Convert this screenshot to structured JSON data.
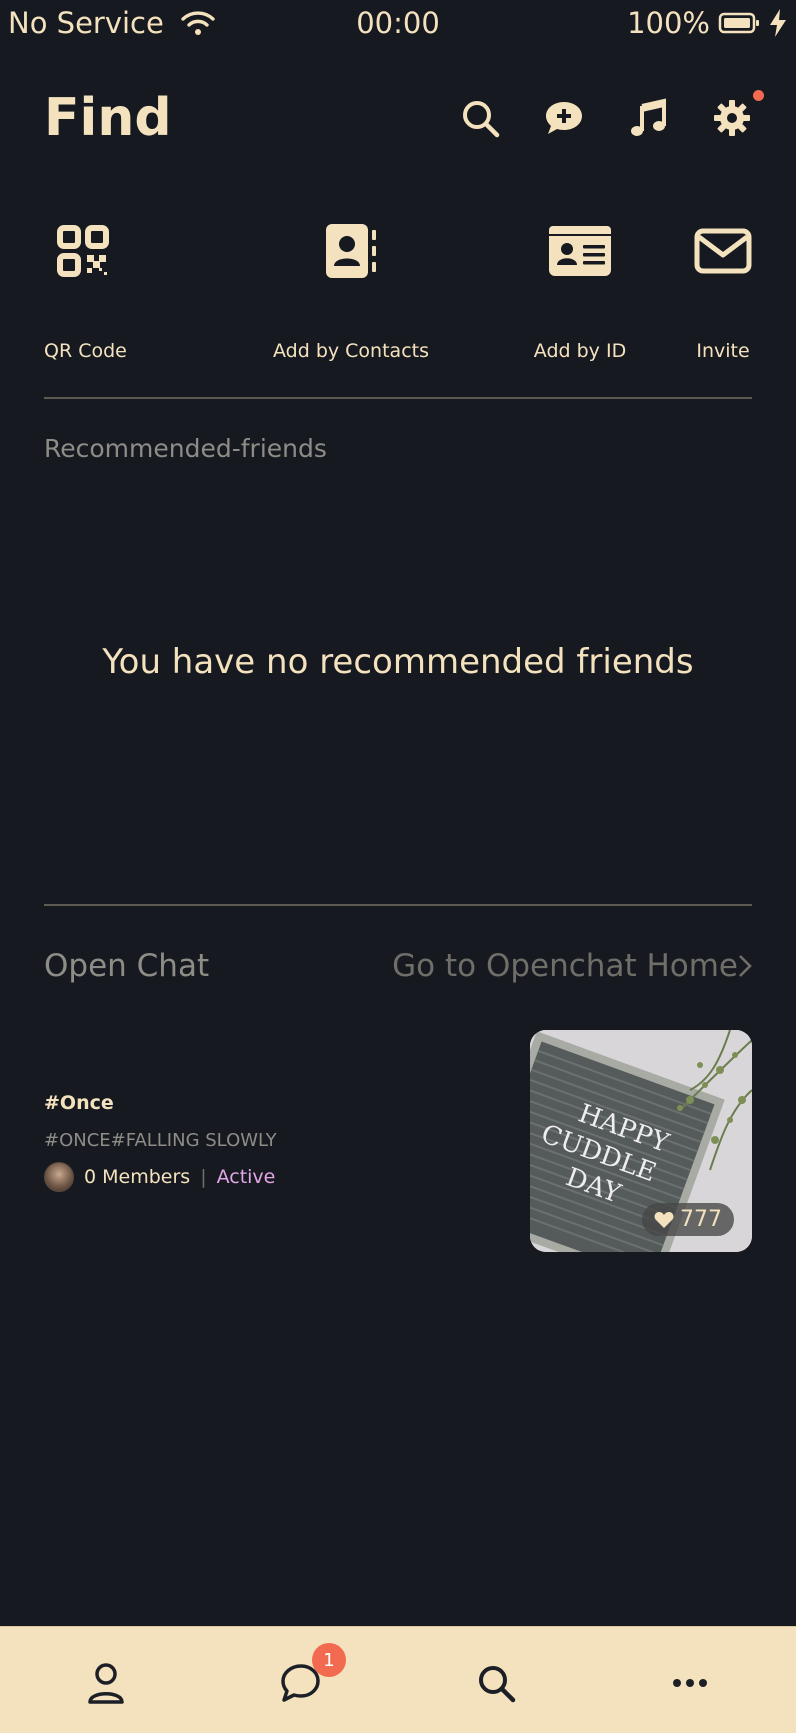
{
  "status_bar": {
    "carrier": "No Service",
    "time": "00:00",
    "battery": "100%"
  },
  "header": {
    "title": "Find",
    "icons": [
      "search-icon",
      "chat-plus-icon",
      "music-icon",
      "gear-icon"
    ],
    "notification_dot_color": "#f26a4f"
  },
  "quick_actions": [
    {
      "label": "QR Code",
      "icon": "qr-code-icon"
    },
    {
      "label": "Add by Contacts",
      "icon": "contacts-icon"
    },
    {
      "label": "Add by ID",
      "icon": "id-card-icon"
    },
    {
      "label": "Invite",
      "icon": "envelope-icon"
    }
  ],
  "recommended": {
    "label": "Recommended-friends",
    "empty_message": "You have no recommended friends"
  },
  "open_chat": {
    "title": "Open Chat",
    "link": "Go to Openchat Home",
    "items": [
      {
        "name": "#Once",
        "tags": "#ONCE#FALLING SLOWLY",
        "members": "0 Members",
        "status": "Active",
        "likes": "777",
        "thumbnail_text": [
          "HAPPY",
          "CUDDLE",
          "DAY"
        ]
      }
    ]
  },
  "tab_bar": {
    "tabs": [
      "profile-icon",
      "chat-icon",
      "search-icon",
      "more-icon"
    ],
    "chat_badge": "1"
  },
  "colors": {
    "background": "#171920",
    "accent": "#f3e2bd",
    "muted": "#8d8c86",
    "badge": "#f26a4f",
    "active": "#e1a6e6"
  }
}
